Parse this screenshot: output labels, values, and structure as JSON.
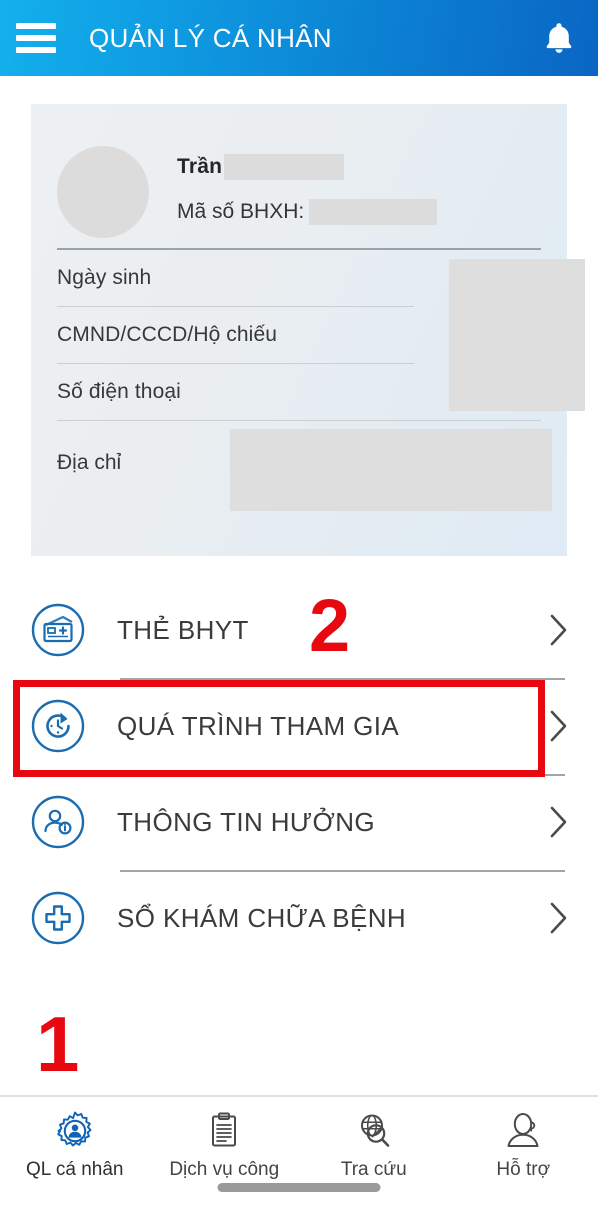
{
  "appbar": {
    "title": "QUẢN LÝ CÁ NHÂN",
    "menu_icon": "hamburger-icon",
    "notification_icon": "bell-icon"
  },
  "profile": {
    "avatar": "avatar-placeholder",
    "name": "Trần",
    "name_redacted": true,
    "bhxh_label": "Mã số BHXH:",
    "bhxh_redacted": true,
    "fields": [
      {
        "label": "Ngày sinh",
        "value_redacted": true
      },
      {
        "label": "CMND/CCCD/Hộ chiếu",
        "value_redacted": true
      },
      {
        "label": "Số điện thoại",
        "value_redacted": true
      }
    ],
    "address": {
      "label": "Địa chỉ",
      "value_redacted": true
    }
  },
  "menu": {
    "items": [
      {
        "label": "THẺ BHYT",
        "icon": "insurance-card-icon",
        "chevron": "chevron-right-icon",
        "highlighted": false
      },
      {
        "label": "QUÁ TRÌNH THAM GIA",
        "icon": "history-clock-icon",
        "chevron": "chevron-right-icon",
        "highlighted": true
      },
      {
        "label": "THÔNG TIN HƯỞNG",
        "icon": "person-info-icon",
        "chevron": "chevron-right-icon",
        "highlighted": false
      },
      {
        "label": "SỔ KHÁM CHỮA BỆNH",
        "icon": "medical-cross-icon",
        "chevron": "chevron-right-icon",
        "highlighted": false
      }
    ]
  },
  "bottom_nav": {
    "items": [
      {
        "label": "QL cá nhân",
        "icon": "gear-person-icon",
        "active": true
      },
      {
        "label": "Dịch vụ công",
        "icon": "clipboard-icon",
        "active": false
      },
      {
        "label": "Tra cứu",
        "icon": "globe-search-icon",
        "active": false
      },
      {
        "label": "Hỗ trợ",
        "icon": "headset-person-icon",
        "active": false
      }
    ]
  },
  "annotations": {
    "step_one": "1",
    "step_two": "2",
    "highlight_color": "#e8080f"
  },
  "colors": {
    "appbar_gradient_start": "#14b0ec",
    "appbar_gradient_end": "#0a66c4",
    "icon_blue": "#1a6cb0",
    "card_background": "#e8edf1",
    "redaction_grey": "#dedede",
    "annotation_red": "#e8080f"
  }
}
